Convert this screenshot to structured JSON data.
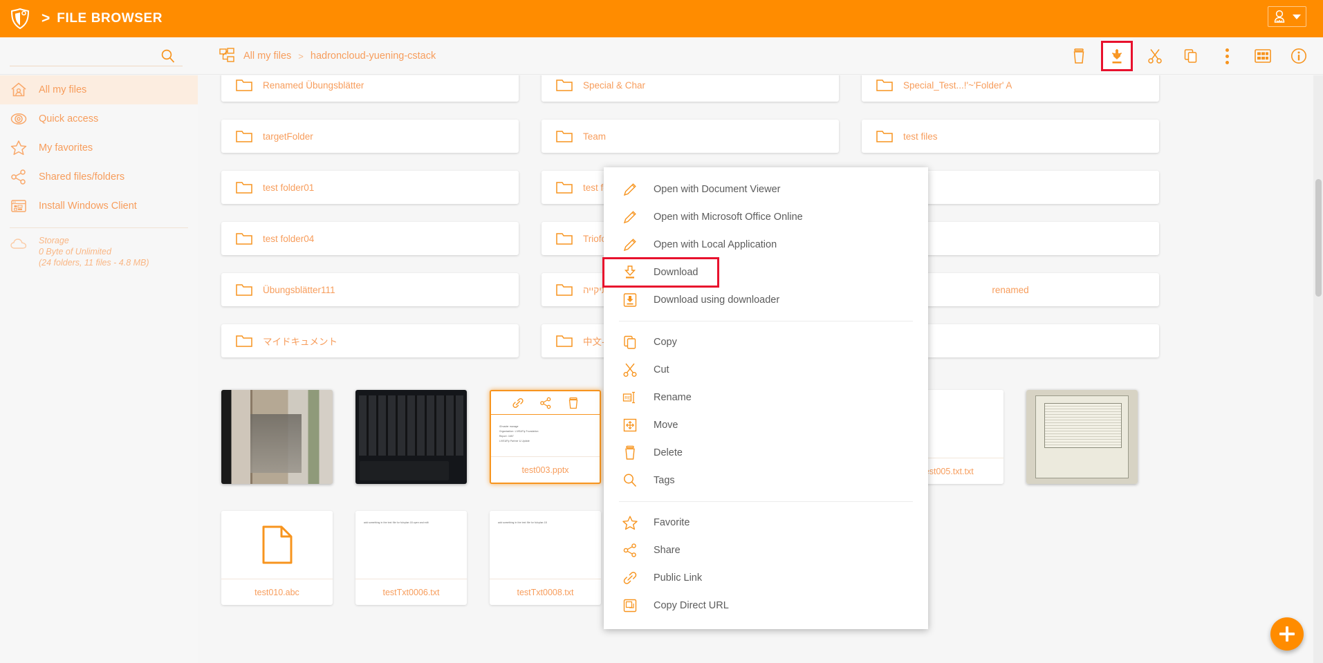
{
  "header": {
    "app_title": "FILE BROWSER",
    "separator": ">",
    "logo_icon": "shield-logo-icon",
    "user_menu_icon": "user-avatar-icon"
  },
  "subbar": {
    "search_icon": "search-icon",
    "breadcrumb_icon": "folder-tree-icon",
    "breadcrumb": [
      {
        "label": "All my files"
      },
      {
        "label": "hadroncloud-yuening-cstack"
      }
    ],
    "breadcrumb_separator": ">",
    "toolbar": [
      {
        "name": "delete-button",
        "icon": "trash-icon",
        "highlighted": false
      },
      {
        "name": "download-button",
        "icon": "download-icon",
        "highlighted": true
      },
      {
        "name": "cut-button",
        "icon": "scissors-icon",
        "highlighted": false
      },
      {
        "name": "copy-button",
        "icon": "copy-icon",
        "highlighted": false
      },
      {
        "name": "more-button",
        "icon": "more-vertical-icon",
        "highlighted": false
      },
      {
        "name": "view-grid-button",
        "icon": "grid-view-icon",
        "highlighted": false
      },
      {
        "name": "info-button",
        "icon": "info-icon",
        "highlighted": false
      }
    ]
  },
  "sidebar": {
    "items": [
      {
        "label": "All my files",
        "icon": "home-user-icon",
        "active": true
      },
      {
        "label": "Quick access",
        "icon": "eye-icon",
        "active": false
      },
      {
        "label": "My favorites",
        "icon": "star-icon",
        "active": false
      },
      {
        "label": "Shared files/folders",
        "icon": "share-nodes-icon",
        "active": false
      },
      {
        "label": "Install Windows Client",
        "icon": "window-app-icon",
        "active": false
      }
    ],
    "storage": {
      "icon": "cloud-icon",
      "title": "Storage",
      "used": "0 Byte of Unlimited",
      "detail": "(24 folders, 11 files - 4.8 MB)"
    }
  },
  "content": {
    "folders": [
      {
        "name": "Renamed Übungsblätter"
      },
      {
        "name": "Special & Char"
      },
      {
        "name": "Special_Test...!'~'Folder' A"
      },
      {
        "name": "targetFolder"
      },
      {
        "name": "Team"
      },
      {
        "name": "test files"
      },
      {
        "name": "test folder01"
      },
      {
        "name": "test folder02"
      },
      {
        "name": ""
      },
      {
        "name": "test folder04"
      },
      {
        "name": "TriofoxD..."
      },
      {
        "name": ""
      },
      {
        "name": "Übungsblätter111"
      },
      {
        "name": "תיקייה בתיקייה"
      },
      {
        "name": "renamed"
      },
      {
        "name": "マイドキュメント"
      },
      {
        "name": "中文-目录"
      },
      {
        "name": ""
      }
    ],
    "files_row1": [
      {
        "name": "",
        "kind": "photo-door",
        "selected": false
      },
      {
        "name": "",
        "kind": "photo-keyboard",
        "selected": false
      },
      {
        "name": "test003.pptx",
        "kind": "document-preview",
        "selected": true,
        "hover_actions": [
          "public-link-icon",
          "share-icon",
          "delete-icon"
        ]
      },
      {
        "name": "",
        "kind": "document-preview",
        "selected": false
      },
      {
        "name": "",
        "kind": "document-preview",
        "selected": false
      },
      {
        "name": "test005.txt.txt",
        "kind": "text-preview",
        "selected": false
      },
      {
        "name": "",
        "kind": "photo-screenshot",
        "selected": false
      }
    ],
    "files_row2": [
      {
        "name": "test010.abc",
        "kind": "generic-file-icon"
      },
      {
        "name": "testTxt0006.txt",
        "kind": "text-preview",
        "preview_text": "add something in the text file for fulxplan 18\nopen and edit"
      },
      {
        "name": "testTxt0008.txt",
        "kind": "text-preview",
        "preview_text": "add something in the text file for fulxplan 18"
      }
    ]
  },
  "context_menu": {
    "groups": [
      {
        "items": [
          {
            "label": "Open with Document Viewer",
            "icon": "pencil-icon",
            "framed": false
          },
          {
            "label": "Open with Microsoft Office Online",
            "icon": "pencil-icon",
            "framed": false
          },
          {
            "label": "Open with Local Application",
            "icon": "pencil-icon",
            "framed": false
          },
          {
            "label": "Download",
            "icon": "download-icon",
            "framed": true
          },
          {
            "label": "Download using downloader",
            "icon": "download-box-icon",
            "framed": false
          }
        ]
      },
      {
        "items": [
          {
            "label": "Copy",
            "icon": "copy-icon",
            "framed": false
          },
          {
            "label": "Cut",
            "icon": "scissors-icon",
            "framed": false
          },
          {
            "label": "Rename",
            "icon": "rename-icon",
            "framed": false
          },
          {
            "label": "Move",
            "icon": "move-icon",
            "framed": false
          },
          {
            "label": "Delete",
            "icon": "trash-icon",
            "framed": false
          },
          {
            "label": "Tags",
            "icon": "magnifier-icon",
            "framed": false
          }
        ]
      },
      {
        "items": [
          {
            "label": "Favorite",
            "icon": "star-icon",
            "framed": false
          },
          {
            "label": "Share",
            "icon": "share-nodes-icon",
            "framed": false
          },
          {
            "label": "Public Link",
            "icon": "link-icon",
            "framed": false
          },
          {
            "label": "Copy Direct URL",
            "icon": "copy-url-icon",
            "framed": false
          }
        ]
      }
    ]
  },
  "fab": {
    "icon": "plus-icon",
    "label": "Add"
  },
  "colors": {
    "brand_orange": "#FF8C00",
    "accent_orange": "#F7941E",
    "text_orange": "#F79D5C",
    "highlight_red": "#E8112D",
    "page_bg": "#F6F6F6",
    "menu_text": "#5B5B5B"
  }
}
